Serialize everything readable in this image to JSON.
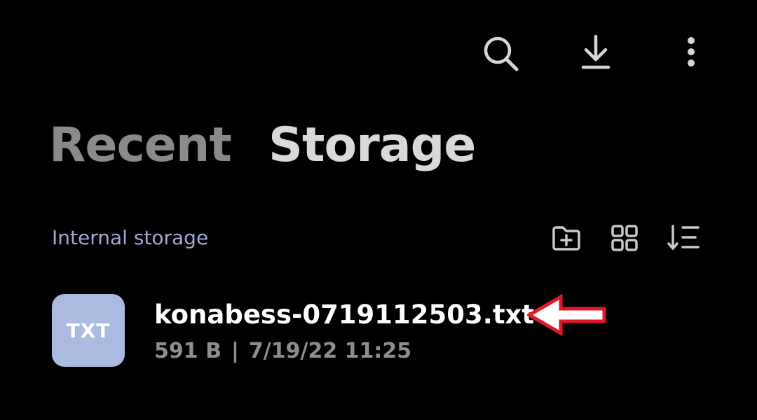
{
  "topbar": {
    "icons": [
      "search-icon",
      "download-icon",
      "more-vert-icon"
    ]
  },
  "tabs": {
    "recent_label": "Recent",
    "storage_label": "Storage",
    "active": "Storage"
  },
  "section": {
    "label": "Internal storage",
    "tools": [
      "new-folder-icon",
      "grid-view-icon",
      "sort-icon"
    ]
  },
  "files": [
    {
      "thumb_label": "TXT",
      "name": "konabess-0719112503.txt",
      "size": "591 B",
      "separator": "|",
      "date": "7/19/22 11:25"
    }
  ],
  "colors": {
    "background": "#000000",
    "accent_label": "#a3a9d4",
    "thumb_bg": "#abbadf",
    "annotation_arrow": "#e3162a"
  }
}
